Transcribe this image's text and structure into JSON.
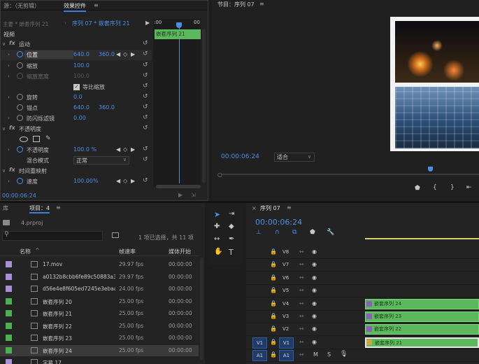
{
  "effect_controls": {
    "tabs": [
      "源：（无剪辑）",
      "效果控件",
      "≡"
    ],
    "master_label": "主要 * 嵌套序列 21",
    "sequence_label": "序列 07 * 嵌套序列 21",
    "ruler_start": ":00",
    "ruler_end": "00",
    "clip_label": "嵌套序列 21",
    "section_video": "视频",
    "fx_motion": "运动",
    "position_label": "位置",
    "position_x": "640.0",
    "position_y": "360.0",
    "scale_label": "缩放",
    "scale_value": "100.0",
    "scale_width_label": "缩放宽度",
    "scale_width_value": "100.0",
    "uniform_scale_label": "等比缩放",
    "rotation_label": "旋转",
    "rotation_value": "0.0",
    "anchor_label": "锚点",
    "anchor_x": "640.0",
    "anchor_y": "360.0",
    "anti_flicker_label": "防闪烁滤镜",
    "anti_flicker_value": "0.00",
    "fx_opacity": "不透明度",
    "opacity_label": "不透明度",
    "opacity_value": "100.0 %",
    "blend_label": "混合模式",
    "blend_value": "正常",
    "fx_time_remap": "时间重映射",
    "speed_label": "速度",
    "speed_value": "100.00%",
    "timecode": "00:00:06:24"
  },
  "program_monitor": {
    "tab": "节目：序列 07",
    "menu": "≡",
    "timecode": "00:00:06:24",
    "fit_label": "适合"
  },
  "project": {
    "tab_library": "库",
    "tab_project": "项目：4",
    "menu": "≡",
    "file_name": "4.prproj",
    "selection_info": "1 项已选择，共 11 项",
    "columns": [
      "名称",
      "帧速率",
      "媒体开始"
    ],
    "rows": [
      {
        "name": "17.mov",
        "fps": "29.97 fps",
        "start": "00:00:00",
        "color": "#a98fd8",
        "selected": false
      },
      {
        "name": "a0132b8cbb6fe89c50883a3",
        "fps": "29.97 fps",
        "start": "00:00:00",
        "color": "#a98fd8",
        "selected": false
      },
      {
        "name": "d56e4e8f605ed7245e3ebaa",
        "fps": "24.00 fps",
        "start": "00:00:00",
        "color": "#a98fd8",
        "selected": false
      },
      {
        "name": "嵌套序列 20",
        "fps": "25.00 fps",
        "start": "00:00:00",
        "color": "#4caf50",
        "selected": false
      },
      {
        "name": "嵌套序列 21",
        "fps": "25.00 fps",
        "start": "00:00:00",
        "color": "#4caf50",
        "selected": false
      },
      {
        "name": "嵌套序列 22",
        "fps": "25.00 fps",
        "start": "00:00:00",
        "color": "#4caf50",
        "selected": false
      },
      {
        "name": "嵌套序列 23",
        "fps": "25.00 fps",
        "start": "00:00:00",
        "color": "#4caf50",
        "selected": false
      },
      {
        "name": "嵌套序列 24",
        "fps": "25.00 fps",
        "start": "00:00:00",
        "color": "#4caf50",
        "selected": true
      },
      {
        "name": "字幕 17",
        "fps": "",
        "start": "",
        "color": "#a98fd8",
        "selected": false
      }
    ]
  },
  "timeline": {
    "tab": "序列 07",
    "menu": "≡",
    "timecode": "00:00:06:24",
    "tracks": [
      {
        "name": "V8",
        "src": ""
      },
      {
        "name": "V7",
        "src": ""
      },
      {
        "name": "V6",
        "src": ""
      },
      {
        "name": "V5",
        "src": ""
      },
      {
        "name": "V4",
        "src": ""
      },
      {
        "name": "V3",
        "src": ""
      },
      {
        "name": "V2",
        "src": ""
      },
      {
        "name": "V1",
        "src": "V1"
      },
      {
        "name": "A1",
        "src": "A1"
      }
    ],
    "clips": [
      {
        "track": "V4",
        "label": "嵌套序列 24"
      },
      {
        "track": "V3",
        "label": "嵌套序列 23"
      },
      {
        "track": "V2",
        "label": "嵌套序列 22"
      },
      {
        "track": "V1",
        "label": "嵌套序列 21"
      }
    ],
    "a1_labels": {
      "mute": "M",
      "solo": "S"
    }
  }
}
